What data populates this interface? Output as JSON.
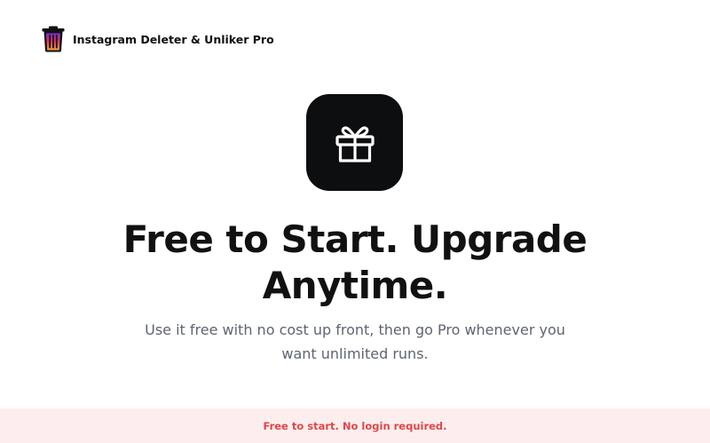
{
  "header": {
    "app_title": "Instagram Deleter & Unliker Pro",
    "logo_icon": "trash-can-icon"
  },
  "hero": {
    "icon": "gift-icon",
    "headline": "Free to Start. Upgrade Anytime.",
    "subtext": "Use it free with no cost up front, then go Pro whenever you want unlimited runs."
  },
  "banner": {
    "text": "Free to start. No login required."
  },
  "colors": {
    "icon_box": "#0d0e10",
    "banner_bg": "#fdeeee",
    "banner_text": "#e0464a",
    "subtext": "#5e6472"
  }
}
